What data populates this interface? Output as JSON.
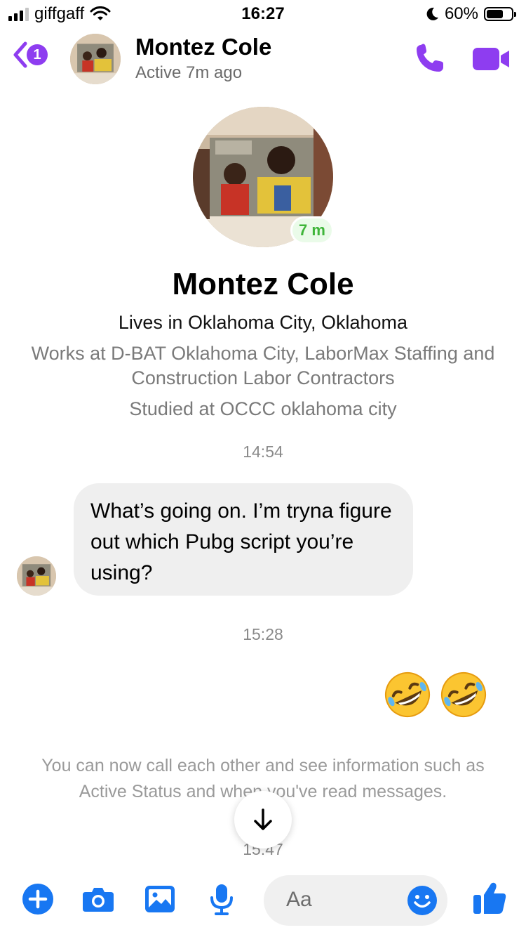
{
  "status_bar": {
    "carrier": "giffgaff",
    "time": "16:27",
    "battery": "60%"
  },
  "header": {
    "back_badge": "1",
    "name": "Montez Cole",
    "status": "Active 7m ago"
  },
  "profile": {
    "active_pill": "7 m",
    "name": "Montez Cole",
    "lives": "Lives in Oklahoma City, Oklahoma",
    "works": "Works at D-BAT Oklahoma City, LaborMax Staffing and Construction Labor Contractors",
    "studied": "Studied at OCCC oklahoma city"
  },
  "messages": {
    "time1": "14:54",
    "incoming_text": "What’s going on. I’m tryna figure out which Pubg script you’re using?",
    "time2": "15:28",
    "outgoing_emoji": [
      "rolling-on-floor-laughing",
      "rolling-on-floor-laughing"
    ],
    "notice": "You can now call each other and see information such as Active Status and when you've read messages.",
    "time3": "15:47"
  },
  "composer": {
    "placeholder": "Aa"
  },
  "colors": {
    "accent_purple": "#8e3df0",
    "messenger_blue": "#1877f2",
    "active_green": "#3fb53a"
  }
}
